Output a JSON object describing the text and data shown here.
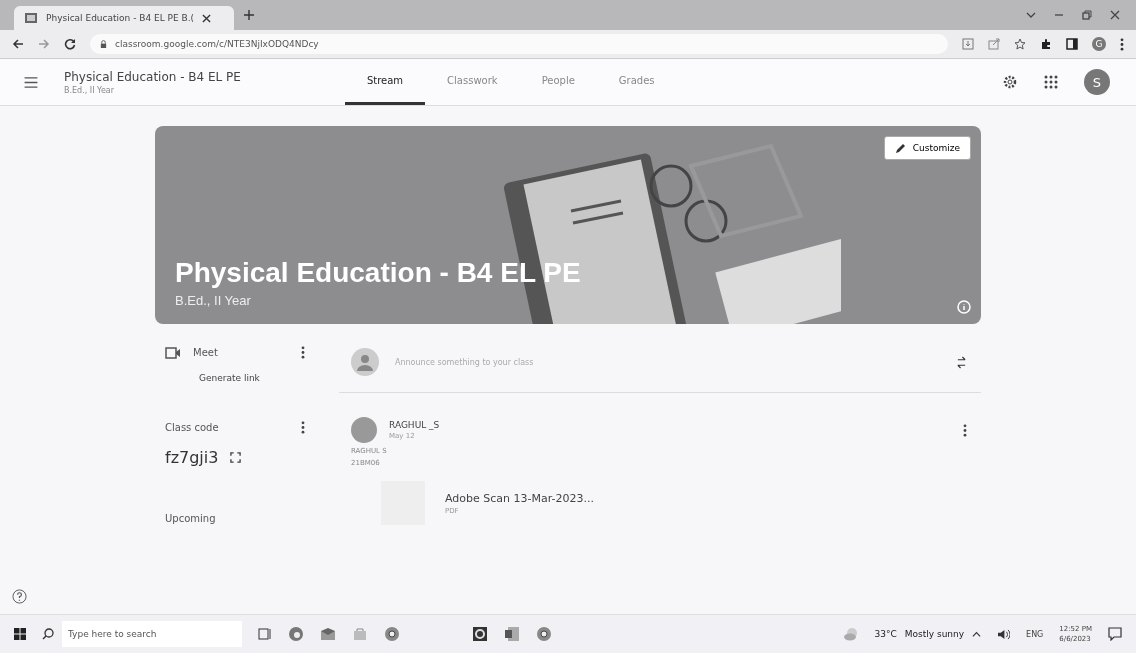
{
  "browser": {
    "tab_title": "Physical Education - B4 EL PE B.(",
    "url": "classroom.google.com/c/NTE3NjIxODQ4NDcy",
    "profile_letter": "G"
  },
  "header": {
    "class_title": "Physical Education - B4 EL PE",
    "class_subtitle": "B.Ed., II Year",
    "account_letter": "S",
    "tabs": [
      {
        "label": "Stream",
        "selected": true
      },
      {
        "label": "Classwork",
        "selected": false
      },
      {
        "label": "People",
        "selected": false
      },
      {
        "label": "Grades",
        "selected": false
      }
    ]
  },
  "banner": {
    "title": "Physical Education - B4 EL PE",
    "subtitle": "B.Ed., II Year",
    "customize_label": "Customize"
  },
  "sidebar": {
    "meet_label": "Meet",
    "generate_link": "Generate link",
    "class_code_label": "Class code",
    "class_code": "fz7gji3",
    "upcoming_label": "Upcoming"
  },
  "announce": {
    "placeholder": "Announce something to your class"
  },
  "post": {
    "author": "RAGHUL _S",
    "date": "May 12",
    "body": [
      "RAGHUL S",
      "21BM06"
    ],
    "attachment": {
      "name": "Adobe Scan 13-Mar-2023...",
      "type": "PDF"
    }
  },
  "taskbar": {
    "search_placeholder": "Type here to search",
    "temperature": "33°C",
    "weather": "Mostly sunny",
    "language": "ENG",
    "time": "12:52 PM",
    "date": "6/6/2023"
  }
}
